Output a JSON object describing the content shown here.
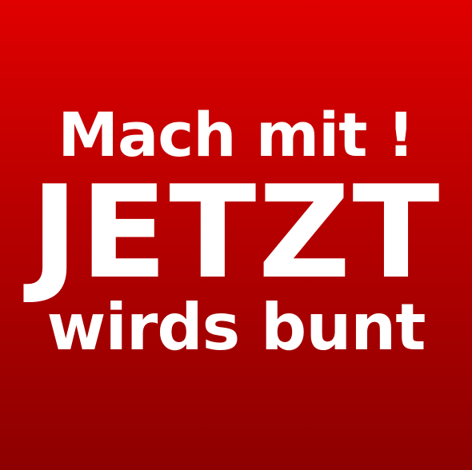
{
  "poster": {
    "line1": "Mach mit !",
    "line2": "JETZT",
    "line3": "wirds bunt",
    "background_top_color": "#e00000",
    "background_bottom_color": "#8e0000",
    "text_color": "#ffffff"
  }
}
